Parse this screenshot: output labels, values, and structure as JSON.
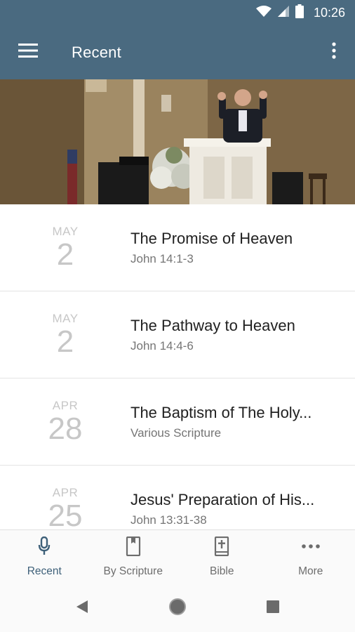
{
  "status": {
    "time": "10:26"
  },
  "app_bar": {
    "title": "Recent"
  },
  "sermons": [
    {
      "month": "MAY",
      "day": "2",
      "title": "The Promise of Heaven",
      "scripture": "John 14:1-3"
    },
    {
      "month": "MAY",
      "day": "2",
      "title": "The Pathway to Heaven",
      "scripture": "John 14:4-6"
    },
    {
      "month": "APR",
      "day": "28",
      "title": "The Baptism of The Holy...",
      "scripture": "Various Scripture"
    },
    {
      "month": "APR",
      "day": "25",
      "title": "Jesus' Preparation of His...",
      "scripture": "John 13:31-38"
    }
  ],
  "bottom_nav": {
    "recent": "Recent",
    "by_scripture": "By Scripture",
    "bible": "Bible",
    "more": "More"
  },
  "colors": {
    "app_bar": "#4a6a80",
    "active_tab": "#3e6079",
    "date_text": "#c7c7c7"
  },
  "icons": {
    "status": [
      "wifi-icon",
      "cell-signal-icon",
      "battery-icon"
    ],
    "app_bar": [
      "hamburger-menu-icon",
      "more-vertical-icon"
    ],
    "bottom_nav": [
      "microphone-icon",
      "book-icon",
      "bible-icon",
      "more-horizontal-icon"
    ],
    "system": [
      "back-icon",
      "home-icon",
      "recents-icon"
    ]
  }
}
